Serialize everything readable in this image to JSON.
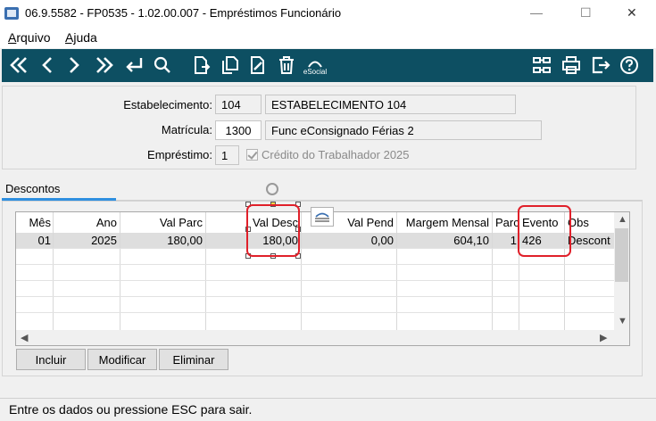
{
  "window": {
    "title": "06.9.5582 - FP0535 - 1.02.00.007 - Empréstimos Funcionário",
    "minimize": "—",
    "maximize": "☐",
    "close": "✕"
  },
  "menu": [
    {
      "first": "A",
      "rest": "rquivo"
    },
    {
      "first": "Aj",
      "rest": "uda"
    }
  ],
  "toolbar": {
    "icons": [
      "first-record-icon",
      "previous-record-icon",
      "next-record-icon",
      "last-record-icon",
      "goto-icon",
      "search-icon",
      "new-record-icon",
      "copy-record-icon",
      "edit-record-icon",
      "delete-record-icon",
      "esocial-icon",
      "export-icon",
      "print-icon",
      "exit-icon",
      "help-icon"
    ],
    "esocial_label": "eSocial"
  },
  "header": {
    "estabelecimento_label": "Estabelecimento:",
    "estabelecimento_code": "104",
    "estabelecimento_name": "ESTABELECIMENTO 104",
    "matricula_label": "Matrícula:",
    "matricula_code": "1300",
    "matricula_name": "Func eConsignado Férias 2",
    "emprestimo_label": "Empréstimo:",
    "emprestimo_value": "1",
    "credito_label": "Crédito do Trabalhador 2025",
    "credito_checked": true
  },
  "tabs": [
    {
      "label": "Descontos",
      "active": true
    }
  ],
  "grid": {
    "columns": [
      "Mês",
      "Ano",
      "Val Parc",
      "Val Desc",
      "Val Pend",
      "Margem Mensal",
      "Parc",
      "Evento",
      "Obs"
    ],
    "rows": [
      [
        "01",
        "2025",
        "180,00",
        "180,00",
        "0,00",
        "604,10",
        "1",
        "426",
        "Descont"
      ]
    ]
  },
  "buttons": {
    "incluir": "Incluir",
    "modificar": "Modificar",
    "eliminar": "Eliminar"
  },
  "status": "Entre os dados ou pressione ESC para sair.",
  "colors": {
    "toolbar": "#0d4f62",
    "tab_accent": "#2f8fe0",
    "highlight": "#e0202a"
  }
}
